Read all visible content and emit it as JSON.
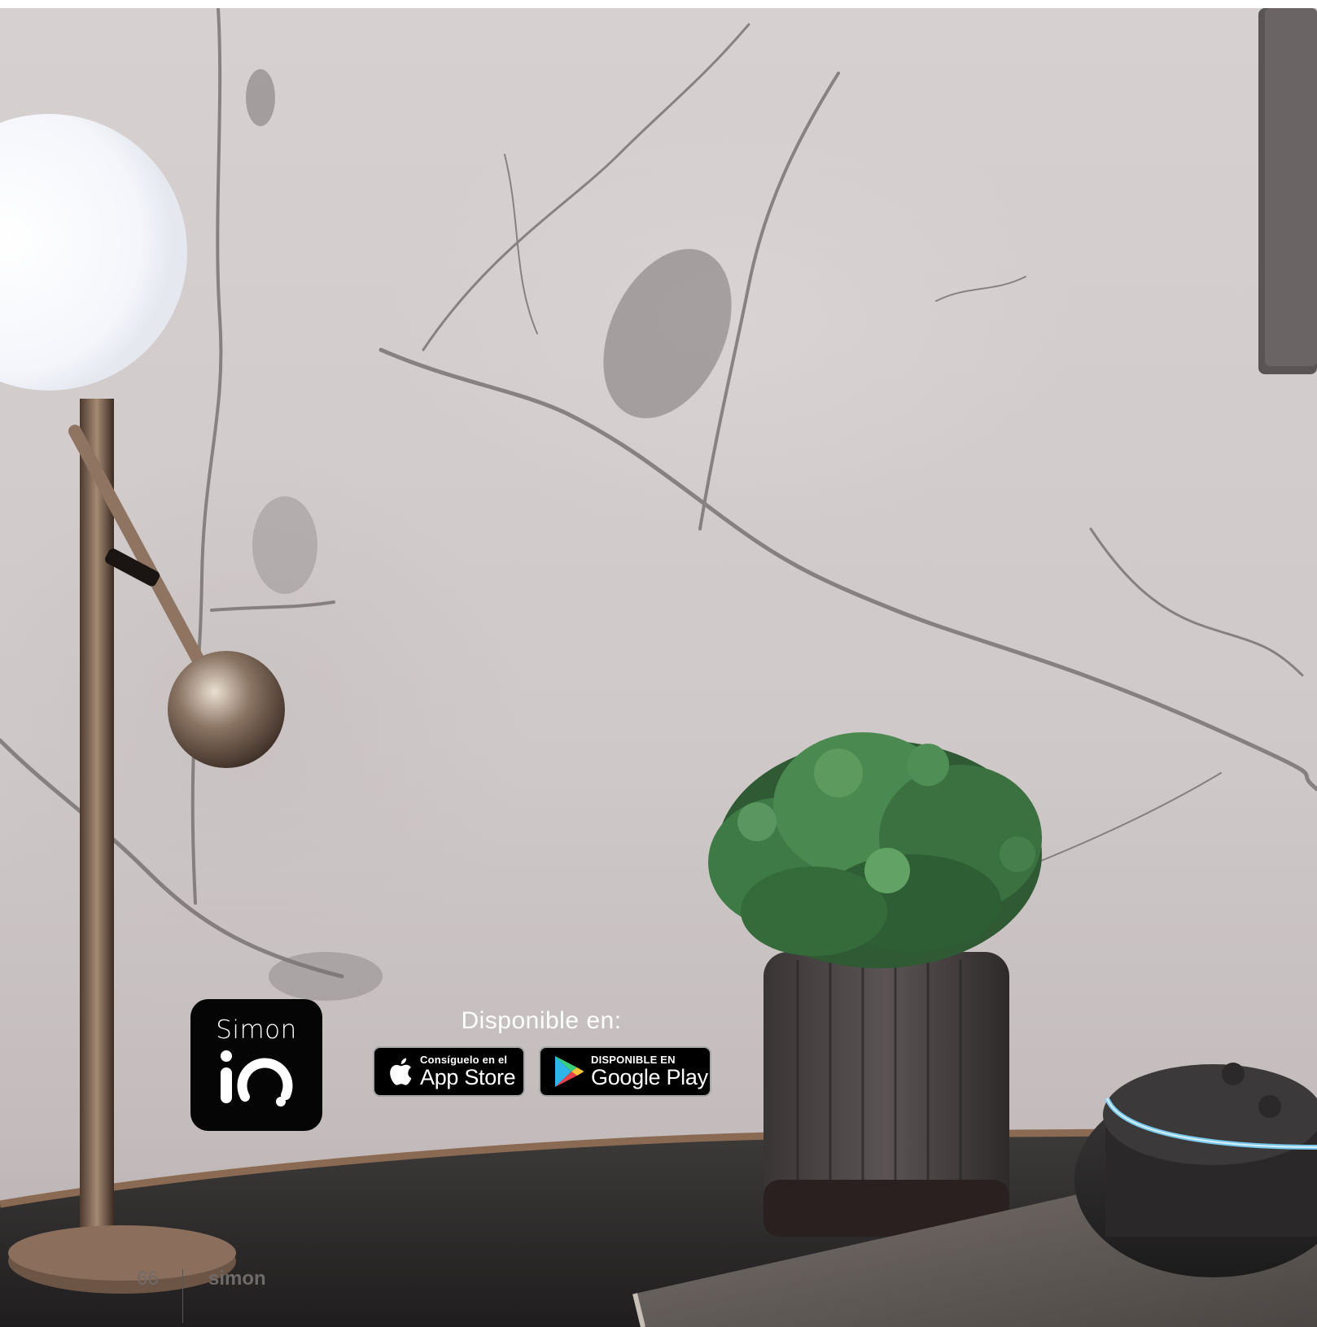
{
  "app_icon": {
    "brand": "Simon",
    "logo_text": "iO",
    "background": "#050505"
  },
  "availability": {
    "label": "Disponible en:"
  },
  "badges": {
    "apple": {
      "small": "Consíguelo en el",
      "big": "App Store",
      "icon": "apple-icon"
    },
    "google": {
      "small": "DISPONIBLE EN",
      "big": "Google Play",
      "icon": "google-play-icon"
    }
  },
  "footer": {
    "page_number": "66",
    "brand": "simon"
  },
  "colors": {
    "marble": "#d2cccc",
    "echo_ring": "#7fd8ff",
    "plant": "#3f7a45"
  }
}
